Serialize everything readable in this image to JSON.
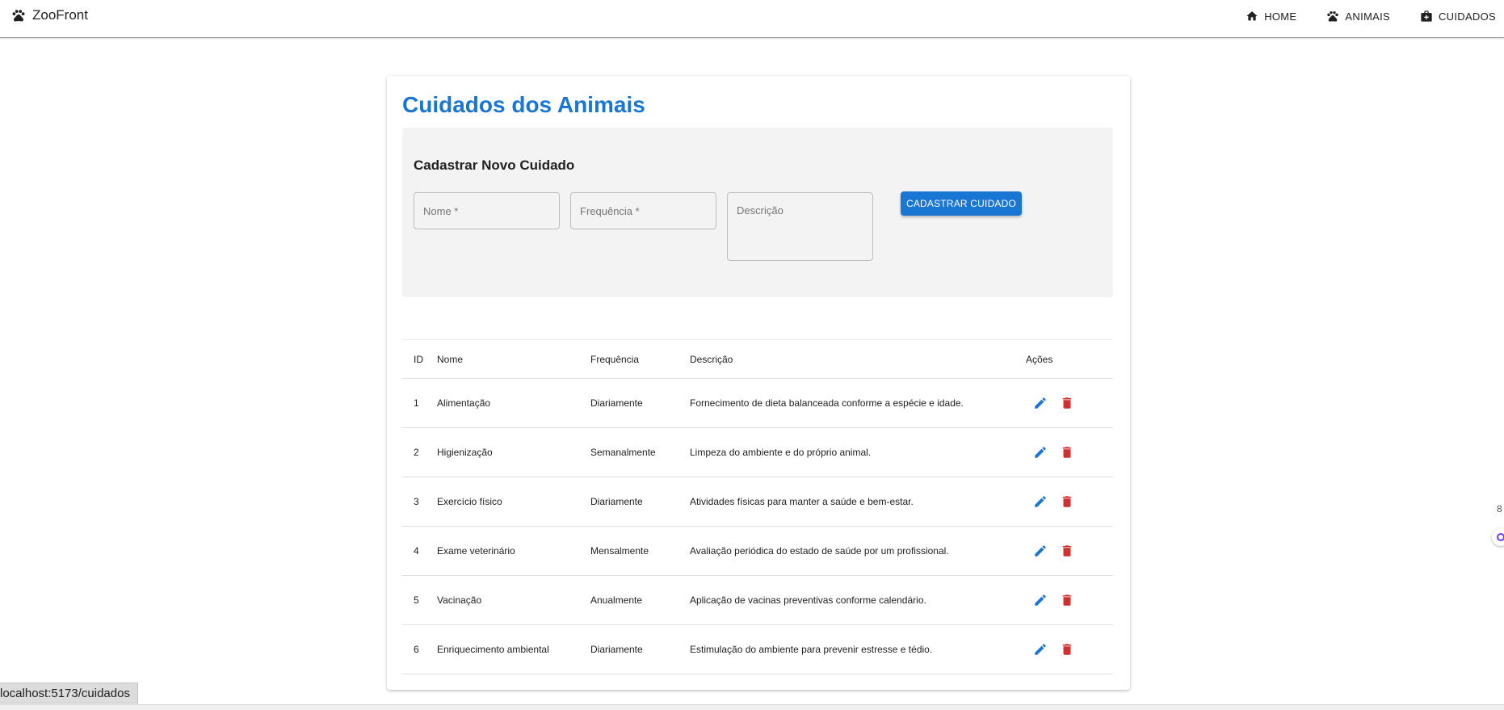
{
  "appbar": {
    "brand": {
      "icon": "paw-icon",
      "name": "ZooFront"
    },
    "nav": [
      {
        "icon": "home-icon",
        "label": "HOME"
      },
      {
        "icon": "paw-icon",
        "label": "ANIMAIS"
      },
      {
        "icon": "medical-bag-icon",
        "label": "CUIDADOS"
      }
    ]
  },
  "page": {
    "title": "Cuidados dos Animais",
    "form": {
      "title": "Cadastrar Novo Cuidado",
      "nome_placeholder": "Nome *",
      "frequencia_placeholder": "Frequência *",
      "descricao_placeholder": "Descrição",
      "submit_label": "CADASTRAR CUIDADO"
    },
    "table": {
      "headers": {
        "id": "ID",
        "nome": "Nome",
        "frequencia": "Frequência",
        "descricao": "Descrição",
        "acoes": "Ações"
      },
      "rows": [
        {
          "id": "1",
          "nome": "Alimentação",
          "frequencia": "Diariamente",
          "descricao": "Fornecimento de dieta balanceada conforme a espécie e idade."
        },
        {
          "id": "2",
          "nome": "Higienização",
          "frequencia": "Semanalmente",
          "descricao": "Limpeza do ambiente e do próprio animal."
        },
        {
          "id": "3",
          "nome": "Exercício físico",
          "frequencia": "Diariamente",
          "descricao": "Atividades físicas para manter a saúde e bem-estar."
        },
        {
          "id": "4",
          "nome": "Exame veterinário",
          "frequencia": "Mensalmente",
          "descricao": "Avaliação periódica do estado de saúde por um profissional."
        },
        {
          "id": "5",
          "nome": "Vacinação",
          "frequencia": "Anualmente",
          "descricao": "Aplicação de vacinas preventivas conforme calendário."
        },
        {
          "id": "6",
          "nome": "Enriquecimento ambiental",
          "frequencia": "Diariamente",
          "descricao": "Estimulação do ambiente para prevenir estresse e tédio."
        }
      ]
    }
  },
  "status_bar": {
    "url": "localhost:5173/cuidados"
  },
  "colors": {
    "primary": "#1976d2",
    "delete": "#d32f2f",
    "form_bg": "#f3f3f3"
  }
}
